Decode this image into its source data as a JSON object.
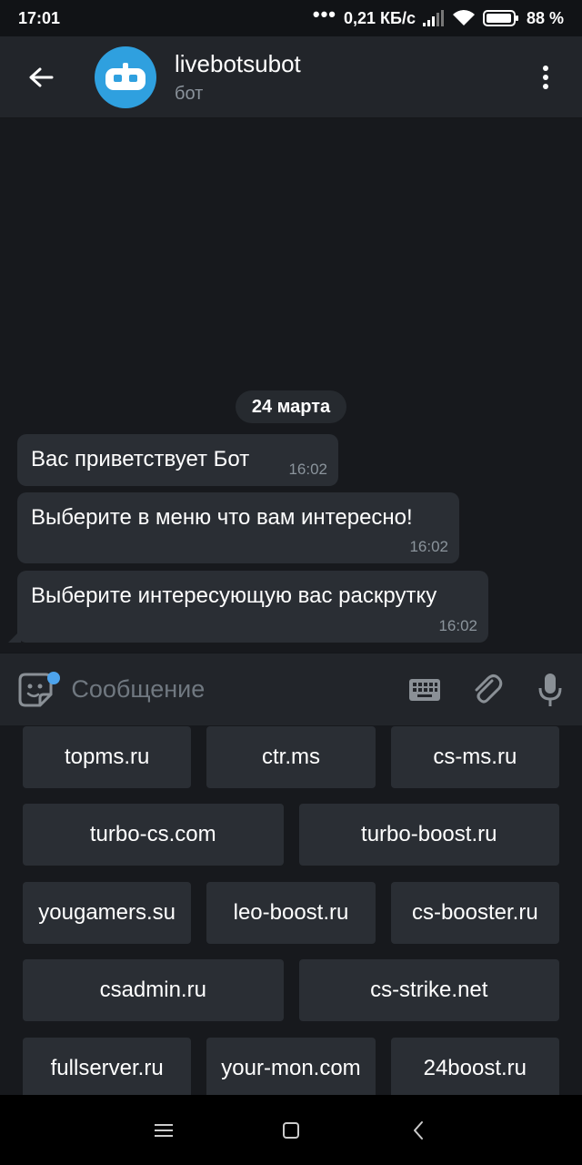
{
  "status_bar": {
    "time": "17:01",
    "net_speed": "0,21 КБ/с",
    "battery": "88 %"
  },
  "header": {
    "title": "livebotsubot",
    "subtitle": "бот",
    "avatar_color": "#2fa0df"
  },
  "chat": {
    "date": "24 марта",
    "messages": [
      {
        "text": "Вас приветствует Бот",
        "time": "16:02"
      },
      {
        "text": "Выберите в меню что вам интересно!",
        "time": "16:02"
      },
      {
        "text": "Выберите интересующую вас раскрутку",
        "time": "16:02"
      }
    ]
  },
  "input": {
    "placeholder": "Сообщение"
  },
  "keyboard": {
    "rows": [
      [
        "topms.ru",
        "ctr.ms",
        "cs-ms.ru"
      ],
      [
        "turbo-cs.com",
        "turbo-boost.ru"
      ],
      [
        "yougamers.su",
        "leo-boost.ru",
        "cs-booster.ru"
      ],
      [
        "csadmin.ru",
        "cs-strike.net"
      ],
      [
        "fullserver.ru",
        "your-mon.com",
        "24boost.ru"
      ]
    ]
  },
  "icons": {
    "back": "arrow-left-icon",
    "menu": "more-vertical-icon",
    "sticker": "sticker-icon",
    "keyboard": "keyboard-icon",
    "attach": "paperclip-icon",
    "mic": "microphone-icon"
  }
}
